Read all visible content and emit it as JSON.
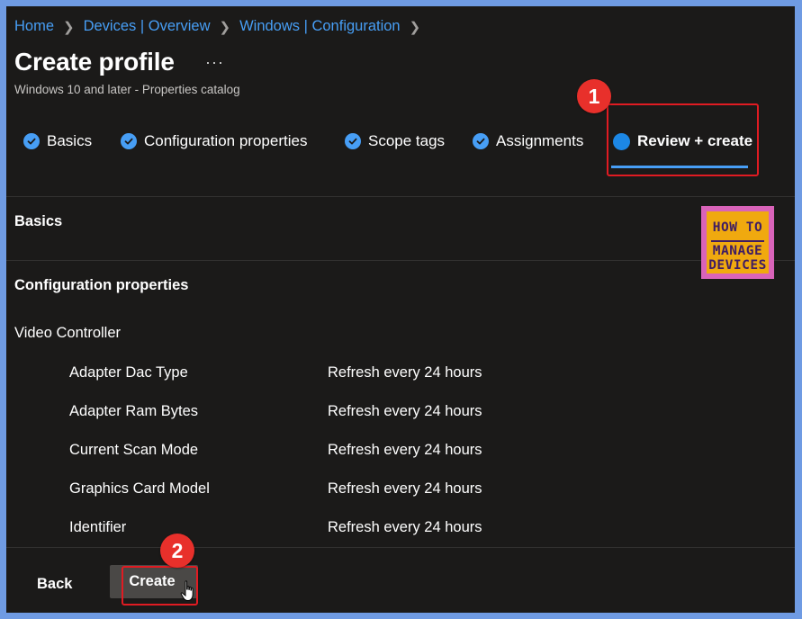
{
  "breadcrumb": {
    "items": [
      "Home",
      "Devices | Overview",
      "Windows | Configuration"
    ],
    "separator": ">"
  },
  "header": {
    "title": "Create profile",
    "more_label": "···",
    "subtitle": "Windows 10 and later - Properties catalog"
  },
  "wizard": {
    "tabs": [
      {
        "label": "Basics",
        "state": "complete"
      },
      {
        "label": "Configuration properties",
        "state": "complete"
      },
      {
        "label": "Scope tags",
        "state": "complete"
      },
      {
        "label": "Assignments",
        "state": "complete"
      },
      {
        "label": "Review + create",
        "state": "current"
      }
    ]
  },
  "review": {
    "basics_heading": "Basics",
    "config_heading": "Configuration properties",
    "group_heading": "Video Controller",
    "settings": [
      {
        "name": "Adapter Dac Type",
        "value": "Refresh every 24 hours"
      },
      {
        "name": "Adapter Ram Bytes",
        "value": "Refresh every 24 hours"
      },
      {
        "name": "Current Scan Mode",
        "value": "Refresh every 24 hours"
      },
      {
        "name": "Graphics Card Model",
        "value": "Refresh every 24 hours"
      },
      {
        "name": "Identifier",
        "value": "Refresh every 24 hours"
      }
    ]
  },
  "footer": {
    "back_label": "Back",
    "create_label": "Create"
  },
  "annotations": {
    "badge_1": "1",
    "badge_2": "2"
  },
  "watermark": {
    "line1": "HOW TO",
    "line2": "MANAGE",
    "line3": "DEVICES"
  },
  "colors": {
    "background": "#1b1a19",
    "accent": "#479ef5",
    "highlight": "#e01b22",
    "frame": "#6f9be3"
  }
}
